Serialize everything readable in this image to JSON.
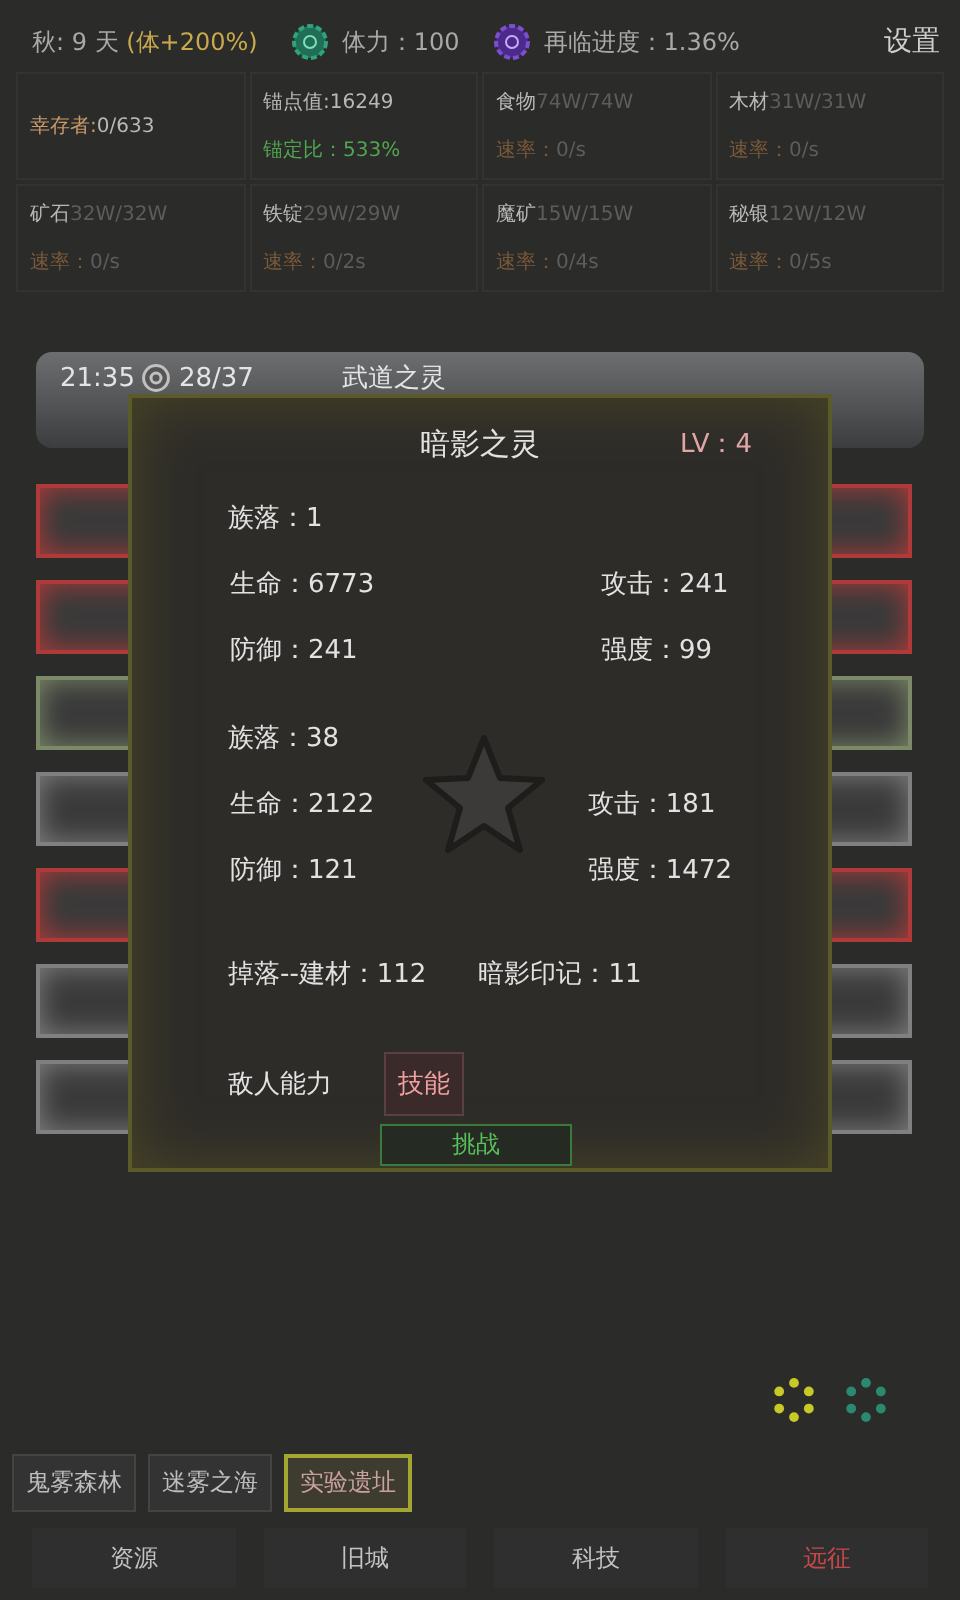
{
  "top_bar": {
    "season": "秋: 9 天",
    "bonus": "(体+200%)",
    "stamina": "体力：100",
    "progress": "再临进度：1.36%",
    "settings": "设置"
  },
  "resources": [
    {
      "kind": "single",
      "label": "幸存者:",
      "value": "0/633"
    },
    {
      "kind": "anchor",
      "label": "锚点值:",
      "value": "16249",
      "sub_label": "锚定比：",
      "sub_value": "533%"
    },
    {
      "kind": "rate",
      "label": "食物",
      "value": "74W/74W",
      "sub_label": "速率：",
      "sub_value": "0/s"
    },
    {
      "kind": "rate",
      "label": "木材",
      "value": "31W/31W",
      "sub_label": "速率：",
      "sub_value": "0/s"
    },
    {
      "kind": "rate",
      "label": "矿石",
      "value": "32W/32W",
      "sub_label": "速率：",
      "sub_value": "0/s"
    },
    {
      "kind": "rate",
      "label": "铁锭",
      "value": "29W/29W",
      "sub_label": "速率：",
      "sub_value": "0/2s"
    },
    {
      "kind": "rate",
      "label": "魔矿",
      "value": "15W/15W",
      "sub_label": "速率：",
      "sub_value": "0/4s"
    },
    {
      "kind": "rate",
      "label": "秘银",
      "value": "12W/12W",
      "sub_label": "速率：",
      "sub_value": "0/5s"
    }
  ],
  "banner": {
    "time": "21:35",
    "count": "28/37",
    "title": "武道之灵"
  },
  "list_rows": [
    {
      "color": "#b03a3a"
    },
    {
      "color": "#b03a3a"
    },
    {
      "color": "#7d8a6a"
    },
    {
      "color": "#808080"
    },
    {
      "color": "#b03a3a"
    },
    {
      "color": "#808080"
    },
    {
      "color": "#808080"
    }
  ],
  "modal": {
    "title": "暗影之灵",
    "level": "LV：4",
    "groups": [
      {
        "tribe": "族落：1",
        "stats": [
          "生命：6773",
          "攻击：241",
          "防御：241",
          "强度：99"
        ]
      },
      {
        "tribe": "族落：38",
        "stats": [
          "生命：2122",
          "攻击：181",
          "防御：121",
          "强度：1472"
        ]
      }
    ],
    "drops": [
      "掉落--建材：112",
      "暗影印记：11"
    ],
    "ability_label": "敌人能力",
    "skill_button": "技能",
    "challenge_button": "挑战"
  },
  "markers": [
    {
      "color": "#c8c828"
    },
    {
      "color": "#2a8a70"
    }
  ],
  "regions": [
    {
      "label": "鬼雾森林",
      "selected": false
    },
    {
      "label": "迷雾之海",
      "selected": false
    },
    {
      "label": "实验遗址",
      "selected": true
    }
  ],
  "nav": [
    {
      "label": "资源",
      "selected": false
    },
    {
      "label": "旧城",
      "selected": false
    },
    {
      "label": "科技",
      "selected": false
    },
    {
      "label": "远征",
      "selected": true
    }
  ]
}
